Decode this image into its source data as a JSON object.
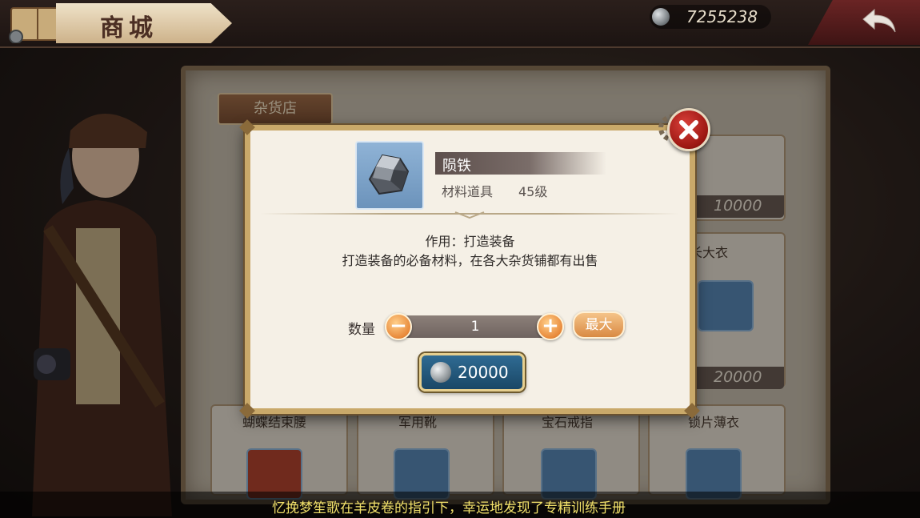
{
  "header": {
    "title": "商城",
    "currency_amount": "7255238"
  },
  "shop": {
    "tab_label": "杂货店",
    "cards": [
      {
        "name": "",
        "price": "10000"
      },
      {
        "name": "长大衣",
        "price": "20000"
      },
      {
        "name": "蝴蝶结束腰",
        "price": ""
      },
      {
        "name": "军用靴",
        "price": ""
      },
      {
        "name": "宝石戒指",
        "price": ""
      },
      {
        "name": "锁片薄衣",
        "price": ""
      }
    ]
  },
  "dialog": {
    "item_name": "陨铁",
    "item_type": "材料道具",
    "item_level": "45级",
    "effect_title": "作用：打造装备",
    "effect_desc": "打造装备的必备材料，在各大杂货铺都有出售",
    "quantity_label": "数量",
    "quantity_value": "1",
    "minus_symbol": "−",
    "plus_symbol": "+",
    "max_label": "最大",
    "price": "20000"
  },
  "ticker": {
    "message": "忆挽梦笙歌在羊皮卷的指引下，幸运地发现了专精训练手册"
  },
  "colors": {
    "accent_orange": "#e8893a",
    "close_red": "#9a1611",
    "buy_blue": "#1a4766",
    "ticker_yellow": "#f2e16a"
  }
}
